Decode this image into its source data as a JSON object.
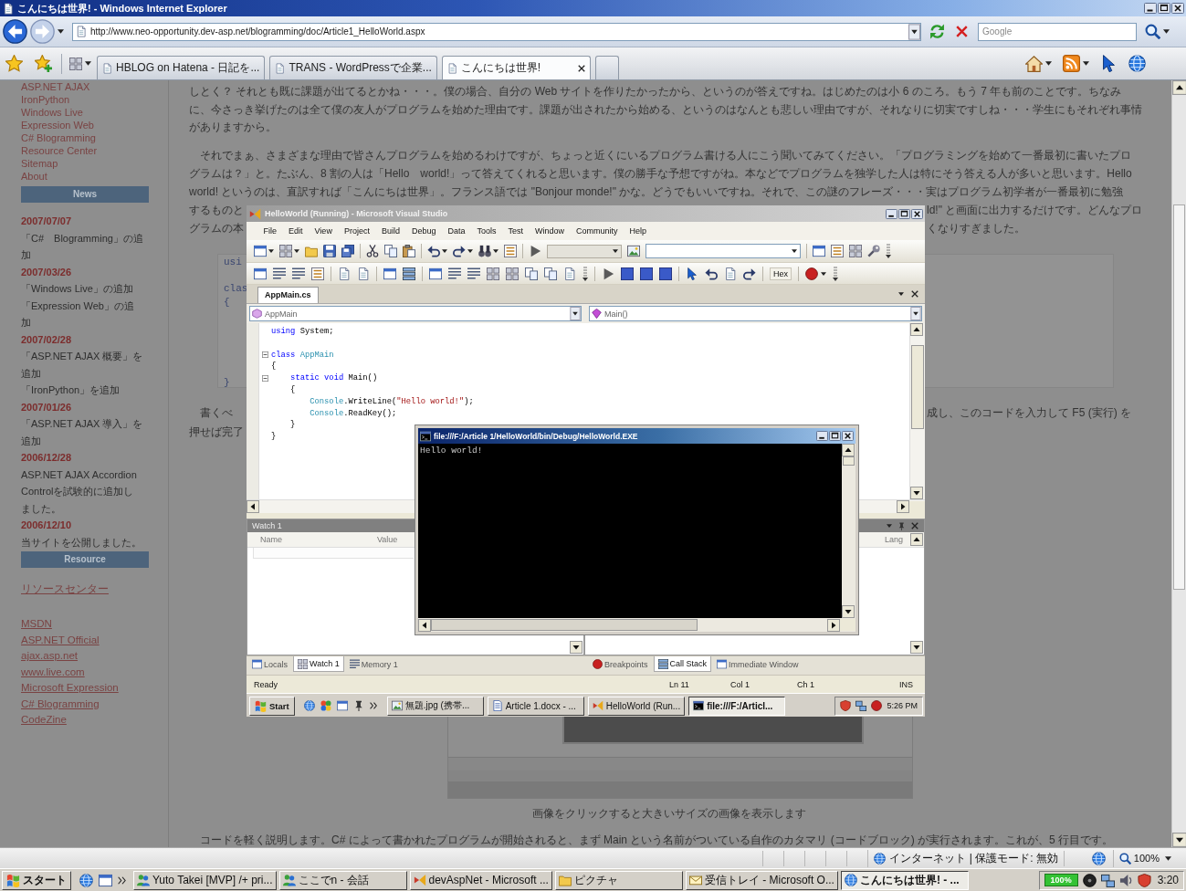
{
  "window": {
    "title": "こんにちは世界! - Windows Internet Explorer"
  },
  "address_bar": {
    "url": "http://www.neo-opportunity.dev-asp.net/blogramming/doc/Article1_HelloWorld.aspx"
  },
  "search": {
    "placeholder": "Google"
  },
  "tabs": [
    {
      "label": "HBLOG on Hatena - 日記を...",
      "selected": false
    },
    {
      "label": "TRANS - WordPressで企業...",
      "selected": false
    },
    {
      "label": "こんにちは世界!",
      "selected": true
    }
  ],
  "sidebar": {
    "nav_links": [
      "ASP.NET AJAX",
      "IronPython",
      "Windows Live",
      "Expression Web",
      "C# Blogramming",
      "Resource Center",
      "Sitemap",
      "About"
    ],
    "news": {
      "heading": "News",
      "entries": [
        {
          "date": "2007/07/07",
          "items": [
            "「C#　Blogramming」の追加"
          ]
        },
        {
          "date": "2007/03/26",
          "items": [
            "「Windows Live」の追加",
            "「Expression Web」の追加"
          ]
        },
        {
          "date": "2007/02/28",
          "items": [
            "「ASP.NET AJAX 概要」を追加",
            "「IronPython」を追加"
          ]
        },
        {
          "date": "2007/01/26",
          "items": [
            "「ASP.NET AJAX 導入」を追加"
          ]
        },
        {
          "date": "2006/12/28",
          "items": [
            "ASP.NET AJAX Accordion Controlを試験的に追加しました。"
          ]
        },
        {
          "date": "2006/12/10",
          "items": [
            "当サイトを公開しました。"
          ]
        }
      ]
    },
    "resource": {
      "heading": "Resource",
      "featured_link": "リソースセンター",
      "links": [
        "MSDN",
        "ASP.NET Official",
        "ajax.asp.net",
        "www.live.com",
        "Microsoft Expression",
        "C# Blogramming",
        "CodeZine"
      ]
    }
  },
  "article": {
    "paragraphs": [
      {
        "lines": [
          "しとく？ それとも既に課題が出てるとかね・・・。僕の場合、自分の Web サイトを作りたかったから、というのが答えですね。はじめたのは小 6 のころ。もう 7 年も前のことです。ちなみ",
          "に、今さっき挙げたのは全て僕の友人がプログラムを始めた理由です。課題が出されたから始める、というのはなんとも悲しい理由ですが、それなりに切実ですしね・・・学生にもそれぞれ事情",
          "がありますから。"
        ]
      },
      {
        "lines": [
          "　それでまぁ、さまざまな理由で皆さんプログラムを始めるわけですが、ちょっと近くにいるプログラム書ける人にこう聞いてみてください。「プログラミングを始めて一番最初に書いたプロ",
          "グラムは？」と。たぶん、8 割の人は「Hello　world!」って答えてくれると思います。僕の勝手な予想ですがね。本などでプログラムを独学した人は特にそう答える人が多いと思います。Hello",
          "world! というのは、直訳すれば「こんにちは世界」。フランス語では \"Bonjour monde!\" かな。どうでもいいですね。それで、この謎のフレーズ・・・実はプログラム初学者が一番最初に勉強"
        ],
        "partial_lines": [
          {
            "left": "するものと",
            "right": "ld!\" と画面に出力するだけです。どんなプロ"
          },
          {
            "left": "グラムの本",
            "right": "くなりすぎました。"
          }
        ]
      }
    ],
    "code_lines": [
      "usi",
      "clas",
      "{",
      "}"
    ],
    "after_code_lines": [
      {
        "left": "　書くべ",
        "right": "成し、このコードを入力して F5 (実行) を"
      },
      {
        "left": "押せば完了"
      }
    ],
    "image_caption": "画像をクリックすると大きいサイズの画像を表示します",
    "closing_paragraph": "　コードを軽く説明します。C# によって書かれたプログラムが開始されると、まず Main という名前がついている自作のカタマリ (コードブロック) が実行されます。これが、5 行目です。"
  },
  "lightbox": {
    "title": "HelloWorld (Running) - Microsoft Visual Studio",
    "menu": [
      "File",
      "Edit",
      "View",
      "Project",
      "Build",
      "Debug",
      "Data",
      "Tools",
      "Test",
      "Window",
      "Community",
      "Help"
    ],
    "hex_button": "Hex",
    "document_tab": "AppMain.cs",
    "type_dropdown": "AppMain",
    "member_dropdown": "Main()",
    "code": [
      {
        "kind": "code",
        "fold": false,
        "tokens": [
          {
            "kind": "keyword",
            "text": "using"
          },
          {
            "kind": "plain",
            "text": " System;"
          }
        ]
      },
      {
        "kind": "blank",
        "fold": false
      },
      {
        "kind": "code",
        "fold": true,
        "tokens": [
          {
            "kind": "keyword",
            "text": "class"
          },
          {
            "kind": "type",
            "text": " AppMain"
          }
        ]
      },
      {
        "kind": "code",
        "fold": false,
        "tokens": [
          {
            "kind": "plain",
            "text": "{"
          }
        ]
      },
      {
        "kind": "code",
        "fold": true,
        "tokens": [
          {
            "kind": "keyword",
            "text": "    static"
          },
          {
            "kind": "keyword",
            "text": " void"
          },
          {
            "kind": "plain",
            "text": " Main()"
          }
        ]
      },
      {
        "kind": "code",
        "fold": false,
        "tokens": [
          {
            "kind": "plain",
            "text": "    {"
          }
        ]
      },
      {
        "kind": "code",
        "fold": false,
        "tokens": [
          {
            "kind": "type",
            "text": "        Console"
          },
          {
            "kind": "plain",
            "text": ".WriteLine("
          },
          {
            "kind": "string",
            "text": "\"Hello world!\""
          },
          {
            "kind": "plain",
            "text": ");"
          }
        ]
      },
      {
        "kind": "code",
        "fold": false,
        "tokens": [
          {
            "kind": "type",
            "text": "        Console"
          },
          {
            "kind": "plain",
            "text": ".ReadKey();"
          }
        ]
      },
      {
        "kind": "code",
        "fold": false,
        "tokens": [
          {
            "kind": "plain",
            "text": "    }"
          }
        ]
      },
      {
        "kind": "code",
        "fold": false,
        "tokens": [
          {
            "kind": "plain",
            "text": "}"
          }
        ]
      }
    ],
    "console": {
      "title": "file:///F:/Article 1/HelloWorld/bin/Debug/HelloWorld.EXE",
      "output": "Hello world!"
    },
    "watch_panel": {
      "title": "Watch 1",
      "columns": [
        "Name",
        "Value"
      ]
    },
    "call_stack_panel": {
      "columns": [
        "Lang"
      ]
    },
    "left_tabs": [
      {
        "label": "Locals",
        "selected": false
      },
      {
        "label": "Watch 1",
        "selected": true
      },
      {
        "label": "Memory 1",
        "selected": false
      }
    ],
    "right_tabs": [
      {
        "label": "Breakpoints",
        "selected": false
      },
      {
        "label": "Call Stack",
        "selected": true
      },
      {
        "label": "Immediate Window",
        "selected": false
      }
    ],
    "status_bar": {
      "message": "Ready",
      "line": "Ln 11",
      "column": "Col 1",
      "char": "Ch 1",
      "mode": "INS"
    },
    "taskbar": {
      "start": "Start",
      "tasks": [
        {
          "label": "無題.jpg (携帯...",
          "selected": false
        },
        {
          "label": "Article 1.docx - ...",
          "selected": false
        },
        {
          "label": "HelloWorld (Run...",
          "selected": false
        },
        {
          "label": "file:///F:/Articl...",
          "selected": true
        }
      ],
      "clock": "5:26 PM"
    }
  },
  "status_bar": {
    "zone": "インターネット | 保護モード: 無効",
    "zoom": "100%"
  },
  "taskbar": {
    "start": "スタート",
    "tasks": [
      {
        "label": "Yuto Takei [MVP] /+ pri...",
        "selected": false
      },
      {
        "label": "ここでn - 会話",
        "selected": false
      },
      {
        "label": "devAspNet - Microsoft ...",
        "selected": false
      },
      {
        "label": "ピクチャ",
        "selected": false
      },
      {
        "label": "受信トレイ - Microsoft O...",
        "selected": false
      },
      {
        "label": "こんにちは世界! - ...",
        "selected": true
      }
    ],
    "battery": "100%",
    "clock": "3:20"
  }
}
